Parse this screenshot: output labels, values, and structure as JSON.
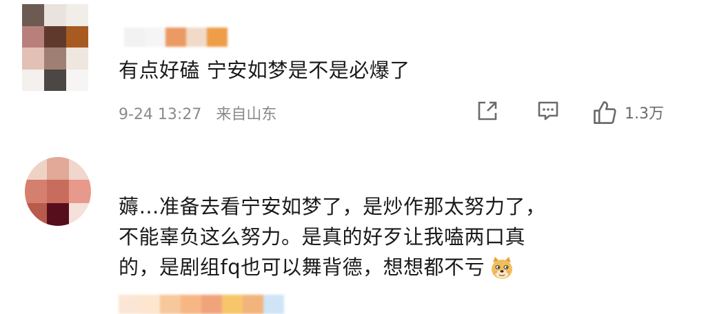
{
  "comments": [
    {
      "avatar_colors": [
        "#6d5a52",
        "#e9e2dd",
        "#f1ede9",
        "#b9807b",
        "#5f3a2c",
        "#a85b20",
        "#e2c0b6",
        "#9f7f73",
        "#efe6df",
        "#f3f0ee",
        "#4c4644",
        "#f7f5f3"
      ],
      "username_colors": [
        "#f2f2f2",
        "#f5f5f5",
        "#ec9a63",
        "#f0dbc8",
        "#ef9d49"
      ],
      "text_lines": [
        "有点好磕 宁安如梦是不是必爆了"
      ],
      "date": "9-24 13:27",
      "location": "来自山东",
      "icons": [
        "share-icon",
        "comment-icon",
        "like-icon"
      ],
      "like_count": "1.3万"
    },
    {
      "avatar_colors": [
        "#eed2c4",
        "#e2a898",
        "#f0d6cc",
        "#d57f6e",
        "#c86d5d",
        "#e79a8c",
        "#b85a4c",
        "#560e1d",
        "#f3e1da"
      ],
      "username_colors": [
        "#fbe6d6",
        "#fde5cf",
        "#f6c89c",
        "#f7b684",
        "#f0a47c",
        "#f8c66a",
        "#f2b47c",
        "#cfe5f7"
      ],
      "text_lines": [
        "薅…准备去看宁安如梦了，是炒作那太努力了，",
        "不能辜负这么努力。是真的好歹让我嗑两口真",
        "的，是剧组fq也可以舞背德，想想都不亏"
      ],
      "emoji": "doge-emoji",
      "accent_colors": {
        "text": "#1a1a1a",
        "meta": "#8a8a8a",
        "icon": "#6a6a6a"
      }
    }
  ]
}
